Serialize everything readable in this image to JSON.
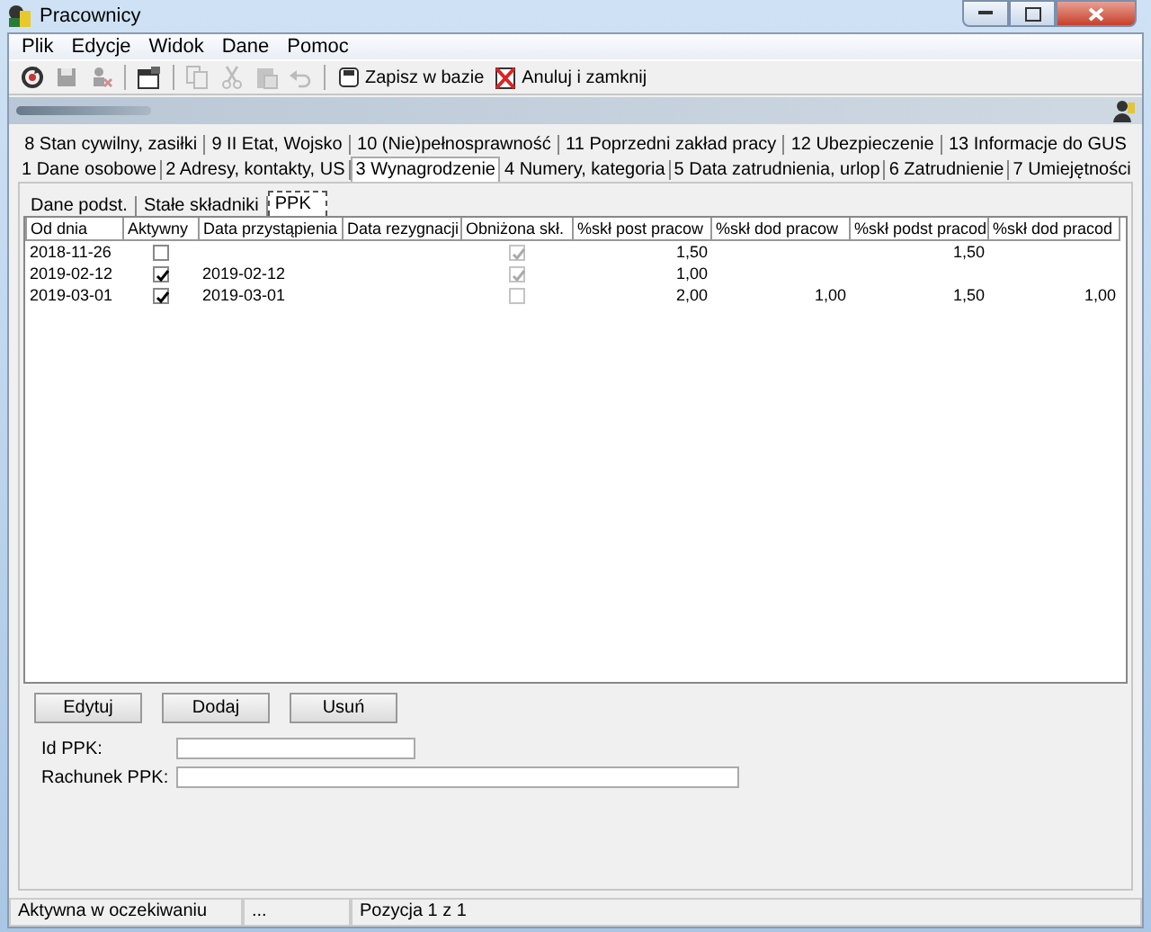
{
  "window": {
    "title": "Pracownicy"
  },
  "menu": [
    "Plik",
    "Edycje",
    "Widok",
    "Dane",
    "Pomoc"
  ],
  "toolbar": [
    {
      "disabled": false
    },
    {
      "disabled": true
    },
    {
      "disabled": true
    },
    {
      "kind": "sep"
    },
    {
      "disabled": false
    },
    {
      "kind": "sep"
    },
    {
      "disabled": true
    },
    {
      "disabled": true
    },
    {
      "disabled": true
    },
    {
      "disabled": true
    },
    {
      "kind": "sep"
    },
    {
      "label": "Zapisz w bazie",
      "disabled": false
    },
    {
      "label": "Anuluj i zamknij",
      "disabled": false
    }
  ],
  "tab_rows": [
    [
      {
        "label": "8 Stan cywilny, zasiłki",
        "selected": false
      },
      {
        "label": "9 II Etat, Wojsko",
        "selected": false
      },
      {
        "label": "10 (Nie)pełnosprawność",
        "selected": false
      },
      {
        "label": "11 Poprzedni zakład pracy",
        "selected": false
      },
      {
        "label": "12 Ubezpieczenie",
        "selected": false
      },
      {
        "label": "13 Informacje do GUS",
        "selected": false
      }
    ],
    [
      {
        "label": "1 Dane osobowe",
        "selected": false
      },
      {
        "label": "2 Adresy, kontakty, US",
        "selected": false
      },
      {
        "label": "3 Wynagrodzenie",
        "selected": true
      },
      {
        "label": "4 Numery, kategoria",
        "selected": false
      },
      {
        "label": "5 Data zatrudnienia, urlop",
        "selected": false
      },
      {
        "label": "6 Zatrudnienie",
        "selected": false
      },
      {
        "label": "7 Umiejętności",
        "selected": false
      }
    ]
  ],
  "subtabs": [
    {
      "label": "Dane podst.",
      "selected": false
    },
    {
      "label": "Stałe składniki",
      "selected": false
    },
    {
      "label": "PPK",
      "selected": true
    }
  ],
  "table": {
    "columns": [
      "Od dnia",
      "Aktywny",
      "Data przystąpienia",
      "Data rezygnacji",
      "Obniżona skł.",
      "%skł post pracow",
      "%skł dod pracow",
      "%skł podst pracod",
      "%skł dod pracod"
    ],
    "rows": [
      {
        "cells": [
          {
            "kind": "text",
            "text": "2018-11-26"
          },
          {
            "kind": "check",
            "checked": false,
            "disabled": false
          },
          {
            "kind": "blank"
          },
          {
            "kind": "blank"
          },
          {
            "kind": "check",
            "checked": true,
            "disabled": true
          },
          {
            "kind": "number",
            "text": "1,50"
          },
          {
            "kind": "blank"
          },
          {
            "kind": "number",
            "text": "1,50"
          },
          {
            "kind": "blank"
          }
        ]
      },
      {
        "cells": [
          {
            "kind": "text",
            "text": "2019-02-12"
          },
          {
            "kind": "check",
            "checked": true,
            "disabled": false
          },
          {
            "kind": "text",
            "text": "2019-02-12"
          },
          {
            "kind": "blank"
          },
          {
            "kind": "check",
            "checked": true,
            "disabled": true
          },
          {
            "kind": "number",
            "text": "1,00"
          },
          {
            "kind": "blank"
          },
          {
            "kind": "blank"
          },
          {
            "kind": "blank"
          }
        ]
      },
      {
        "cells": [
          {
            "kind": "text",
            "text": "2019-03-01"
          },
          {
            "kind": "check",
            "checked": true,
            "disabled": false
          },
          {
            "kind": "text",
            "text": "2019-03-01"
          },
          {
            "kind": "blank"
          },
          {
            "kind": "check",
            "checked": false,
            "disabled": true
          },
          {
            "kind": "number",
            "text": "2,00"
          },
          {
            "kind": "number",
            "text": "1,00"
          },
          {
            "kind": "number",
            "text": "1,50"
          },
          {
            "kind": "number",
            "text": "1,00"
          }
        ]
      }
    ]
  },
  "buttons": [
    "Edytuj",
    "Dodaj",
    "Usuń"
  ],
  "fields": [
    {
      "label": "Id PPK:"
    },
    {
      "label": "Rachunek PPK:"
    }
  ],
  "status_bar": [
    "Aktywna w oczekiwaniu",
    "...",
    "Pozycja 1 z 1"
  ]
}
